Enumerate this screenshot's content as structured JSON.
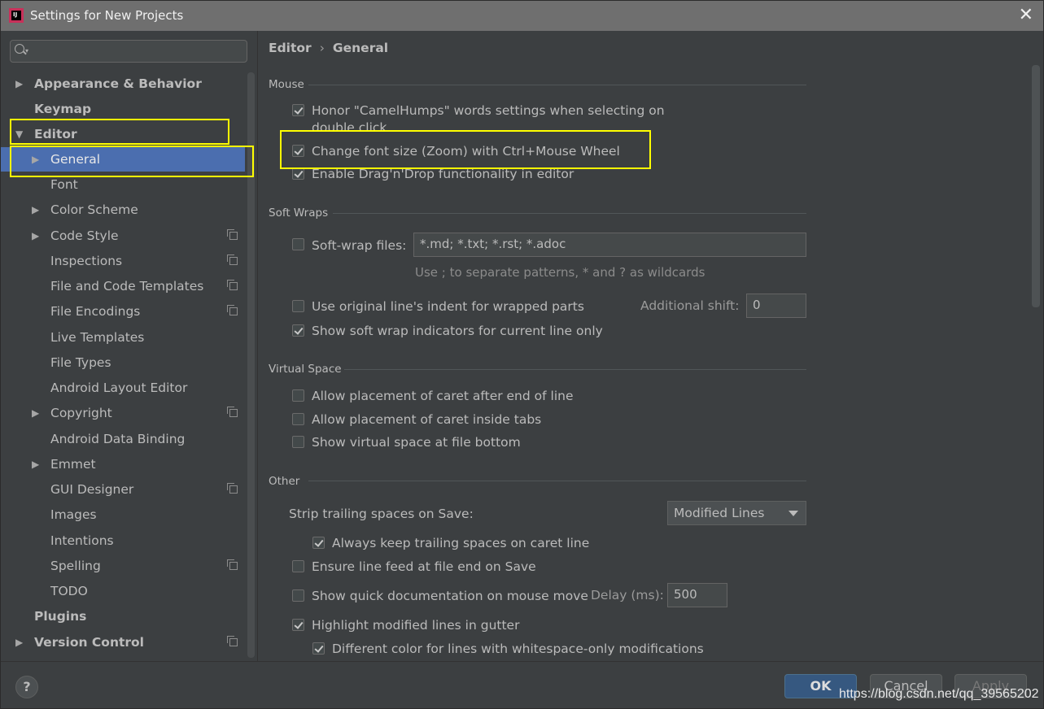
{
  "window": {
    "title": "Settings for New Projects",
    "icon_text": "IJ"
  },
  "search": {
    "placeholder": ""
  },
  "tree": {
    "items": [
      {
        "label": "Appearance & Behavior",
        "arrow": "▶"
      },
      {
        "label": "Keymap",
        "arrow": ""
      },
      {
        "label": "Editor",
        "arrow": "▼"
      },
      {
        "label": "General",
        "arrow": "▶"
      },
      {
        "label": "Font",
        "arrow": ""
      },
      {
        "label": "Color Scheme",
        "arrow": "▶"
      },
      {
        "label": "Code Style",
        "arrow": "▶"
      },
      {
        "label": "Inspections",
        "arrow": ""
      },
      {
        "label": "File and Code Templates",
        "arrow": ""
      },
      {
        "label": "File Encodings",
        "arrow": ""
      },
      {
        "label": "Live Templates",
        "arrow": ""
      },
      {
        "label": "File Types",
        "arrow": ""
      },
      {
        "label": "Android Layout Editor",
        "arrow": ""
      },
      {
        "label": "Copyright",
        "arrow": "▶"
      },
      {
        "label": "Android Data Binding",
        "arrow": ""
      },
      {
        "label": "Emmet",
        "arrow": "▶"
      },
      {
        "label": "GUI Designer",
        "arrow": ""
      },
      {
        "label": "Images",
        "arrow": ""
      },
      {
        "label": "Intentions",
        "arrow": ""
      },
      {
        "label": "Spelling",
        "arrow": ""
      },
      {
        "label": "TODO",
        "arrow": ""
      },
      {
        "label": "Plugins",
        "arrow": ""
      },
      {
        "label": "Version Control",
        "arrow": "▶"
      }
    ],
    "selected": "General"
  },
  "breadcrumb": {
    "part1": "Editor",
    "sep": "›",
    "part2": "General"
  },
  "mouse": {
    "title": "Mouse",
    "camelhumps_line1": "Honor \"CamelHumps\" words settings when selecting on",
    "camelhumps_line2": "double click",
    "camelhumps_checked": true,
    "zoom": "Change font size (Zoom) with Ctrl+Mouse Wheel",
    "zoom_checked": true,
    "dnd": "Enable Drag'n'Drop functionality in editor",
    "dnd_checked": true
  },
  "soft_wraps": {
    "title": "Soft Wraps",
    "files_label": "Soft-wrap files:",
    "files_checked": false,
    "files_value": "*.md; *.txt; *.rst; *.adoc",
    "hint": "Use ; to separate patterns, * and ? as wildcards",
    "indent": "Use original line's indent for wrapped parts",
    "indent_checked": false,
    "shift_label": "Additional shift:",
    "shift_value": "0",
    "indicators": "Show soft wrap indicators for current line only",
    "indicators_checked": true
  },
  "virtual_space": {
    "title": "Virtual Space",
    "after_eol": "Allow placement of caret after end of line",
    "inside_tabs": "Allow placement of caret inside tabs",
    "file_bottom": "Show virtual space at file bottom"
  },
  "other": {
    "title": "Other",
    "strip_label": "Strip trailing spaces on Save:",
    "strip_value": "Modified Lines",
    "keep_caret": "Always keep trailing spaces on caret line",
    "keep_caret_checked": true,
    "line_feed": "Ensure line feed at file end on Save",
    "line_feed_checked": false,
    "quick_doc": "Show quick documentation on mouse move",
    "quick_doc_checked": false,
    "delay_label": "Delay (ms):",
    "delay_value": "500",
    "highlight_modified": "Highlight modified lines in gutter",
    "highlight_modified_checked": true,
    "diff_color": "Different color for lines with whitespace-only modifications",
    "diff_color_checked": true
  },
  "buttons": {
    "help": "?",
    "ok": "OK",
    "cancel": "Cancel",
    "apply": "Apply"
  },
  "watermark": "https://blog.csdn.net/qq_39565202",
  "colors": {
    "selection": "#4b6eaf",
    "highlight_box": "#ffff00",
    "background": "#3c3f41"
  }
}
